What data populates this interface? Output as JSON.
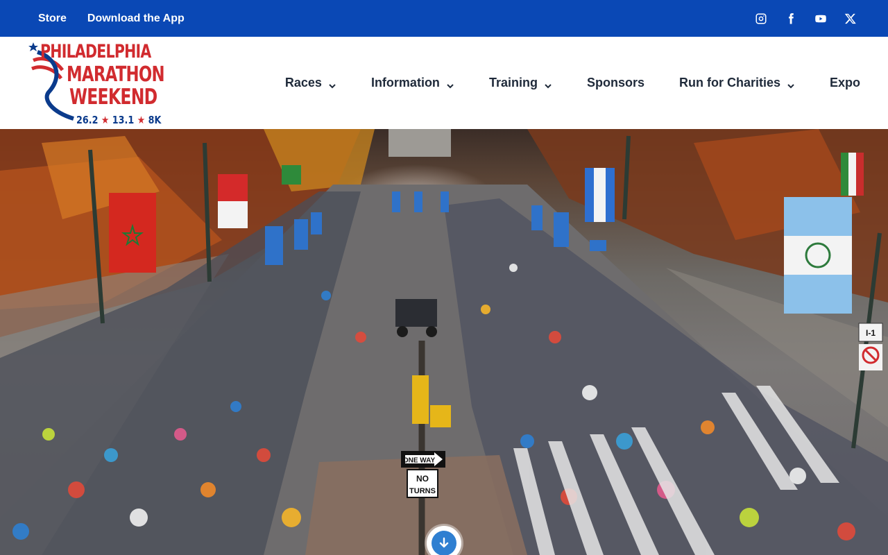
{
  "utility": {
    "links": [
      "Store",
      "Download the App"
    ],
    "social": [
      "instagram-icon",
      "facebook-icon",
      "youtube-icon",
      "x-icon"
    ]
  },
  "logo": {
    "line1": "PHILADELPHIA",
    "line2": "MARATHON",
    "line3": "WEEKEND",
    "dist1": "26.2",
    "dist2": "13.1",
    "dist3": "8K"
  },
  "nav": {
    "races": "Races",
    "information": "Information",
    "training": "Training",
    "sponsors": "Sponsors",
    "charities": "Run for Charities",
    "expo": "Expo"
  },
  "hero": {
    "sign_one_way": "ONE WAY",
    "sign_no": "NO",
    "sign_turns": "TURNS",
    "sign_route": "I-1"
  },
  "colors": {
    "utility_bg": "#0a48b5",
    "brand_red": "#d12b2f",
    "brand_blue": "#0b3b8c",
    "nav_text": "#1f2a3a",
    "scroll_button": "#2f7fd1"
  }
}
